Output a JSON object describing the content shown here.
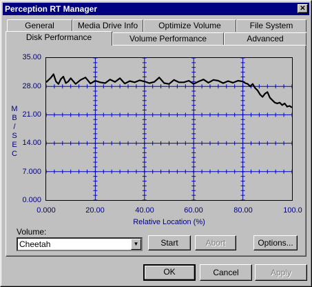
{
  "window": {
    "title": "Perception RT Manager",
    "close_glyph": "✕"
  },
  "tabs_row1": [
    "General",
    "Media Drive Info",
    "Optimize Volume",
    "File System"
  ],
  "tabs_row2": [
    "Disk Performance",
    "Volume Performance",
    "Advanced"
  ],
  "active_tab": "Disk Performance",
  "volume": {
    "label": "Volume:",
    "selected": "Cheetah"
  },
  "buttons": {
    "start": "Start",
    "abort": "Abort",
    "options": "Options...",
    "ok": "OK",
    "cancel": "Cancel",
    "apply": "Apply"
  },
  "chart_data": {
    "type": "line",
    "ylabel": "MB/SEC",
    "xlabel": "Relative Location (%)",
    "xlim": [
      0,
      100
    ],
    "ylim": [
      0,
      35
    ],
    "y_ticks": [
      "35.00",
      "28.00",
      "21.00",
      "14.00",
      "7.000",
      "0.000"
    ],
    "x_ticks": [
      "0.000",
      "20.00",
      "40.00",
      "60.00",
      "80.00",
      "100.0"
    ],
    "grid": true,
    "series": [
      {
        "color": "#000000",
        "x": [
          0,
          1,
          2,
          3,
          4,
          5,
          6,
          7,
          8,
          9,
          10,
          12,
          14,
          16,
          18,
          20,
          22,
          24,
          26,
          28,
          30,
          32,
          34,
          36,
          38,
          40,
          42,
          44,
          46,
          48,
          50,
          52,
          54,
          56,
          58,
          60,
          62,
          64,
          66,
          68,
          70,
          72,
          74,
          76,
          78,
          80,
          81,
          82,
          83,
          84,
          85,
          86,
          87,
          88,
          89,
          90,
          91,
          92,
          93,
          94,
          95,
          96,
          97,
          98,
          99,
          100
        ],
        "y": [
          29.0,
          29.6,
          30.2,
          31.0,
          29.2,
          28.6,
          29.8,
          30.4,
          28.8,
          29.2,
          30.0,
          28.6,
          29.6,
          30.2,
          28.7,
          29.4,
          29.0,
          28.8,
          29.7,
          29.1,
          30.0,
          28.7,
          29.3,
          29.0,
          29.5,
          29.2,
          28.8,
          29.1,
          30.2,
          28.8,
          28.6,
          29.6,
          29.0,
          29.0,
          29.4,
          28.6,
          29.2,
          29.7,
          28.9,
          29.6,
          29.4,
          28.8,
          29.3,
          28.9,
          29.4,
          29.2,
          28.8,
          28.6,
          28.0,
          28.6,
          27.6,
          27.0,
          26.0,
          25.4,
          26.2,
          26.6,
          25.2,
          24.6,
          24.0,
          23.8,
          24.0,
          23.4,
          23.8,
          23.0,
          23.2,
          22.8
        ]
      }
    ]
  }
}
